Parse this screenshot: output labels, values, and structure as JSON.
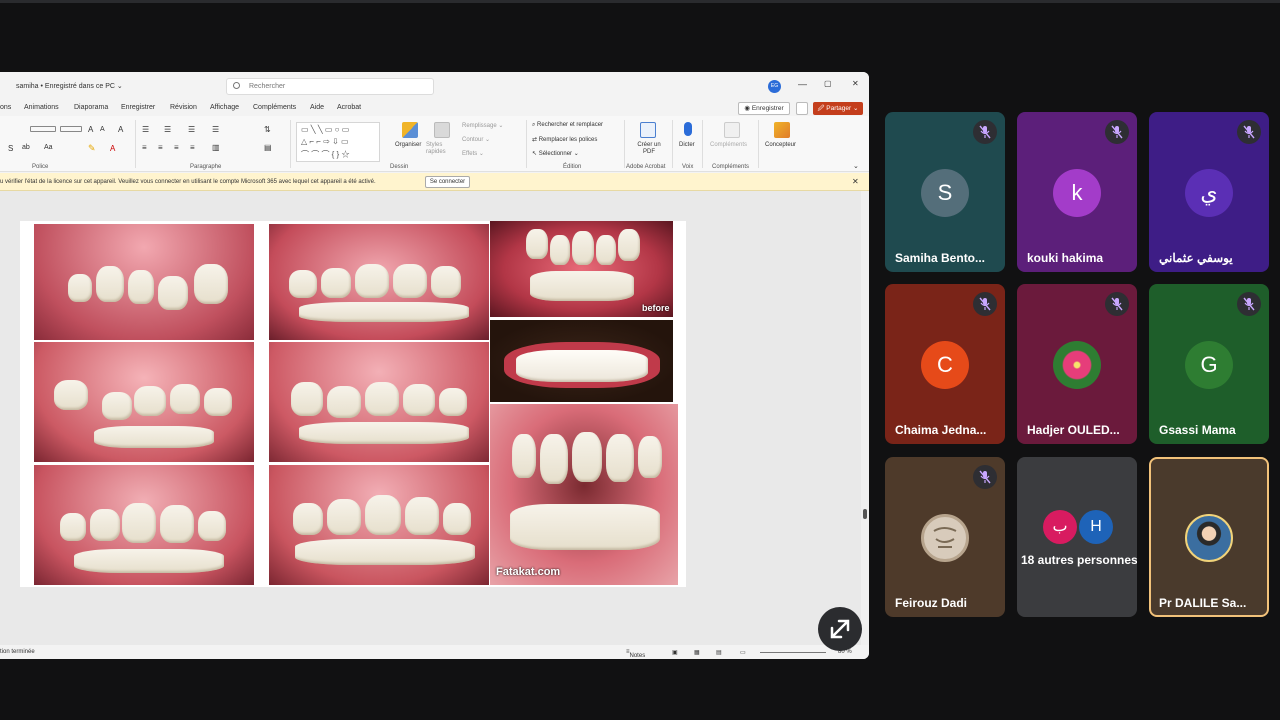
{
  "window": {
    "doc_title": "samiha • Enregistré dans ce PC ⌄",
    "search_placeholder": "Rechercher",
    "user_initials": "EG",
    "minimize": "—",
    "maximize": "▢",
    "close": "✕"
  },
  "menu": [
    "ons",
    "Animations",
    "Diaporama",
    "Enregistrer",
    "Révision",
    "Affichage",
    "Compléments",
    "Aide",
    "Acrobat"
  ],
  "actions": {
    "record": "◉ Enregistrer",
    "share": "🖉 Partager ⌄"
  },
  "ribbon": {
    "groups": [
      "Police",
      "Paragraphe",
      "Dessin",
      "Édition",
      "Adobe Acrobat",
      "Voix",
      "Compléments"
    ],
    "find_replace": "Rechercher et remplacer",
    "replace_fonts": "Remplacer les polices",
    "select": "Sélectionner ⌄",
    "organize": "Organiser",
    "quick_styles": "Styles rapides",
    "fill": "Remplissage ⌄",
    "outline": "Contour ⌄",
    "effects": "Effets ⌄",
    "create_pdf": "Créer un PDF",
    "dictate": "Dicter",
    "addins": "Compléments",
    "designer": "Concepteur"
  },
  "infobar": {
    "message": "u vérifier l'état de la licence sur cet appareil. Veuillez vous connecter en utilisant le compte Microsoft 365 avec lequel cet appareil a été activé.",
    "signin": "Se connecter",
    "dismiss": "✕"
  },
  "slide": {
    "caption_before": "before",
    "caption_watermark": "Fatakat.com"
  },
  "status": {
    "left": "tion terminée",
    "notes": "Notes",
    "zoom": "80 %"
  },
  "participants": [
    {
      "name": "Samiha Bento...",
      "initial": "S",
      "avatar_color": "#546e7a",
      "bg": "#1f4a4f",
      "muted": true
    },
    {
      "name": "kouki hakima",
      "initial": "k",
      "avatar_color": "#a33cc9",
      "bg": "#5c1f7a",
      "muted": true
    },
    {
      "name": "يوسفي عثماني",
      "initial": "ي",
      "avatar_color": "#5b2fb5",
      "bg": "#3e1d86",
      "muted": true
    },
    {
      "name": "Chaima Jedna...",
      "initial": "C",
      "avatar_color": "#e64a19",
      "bg": "#7a2418",
      "muted": true
    },
    {
      "name": "Hadjer OULED...",
      "initial": "",
      "avatar_color": "#2e7d32",
      "bg": "#6b1a3c",
      "muted": true
    },
    {
      "name": "Gsassi Mama",
      "initial": "G",
      "avatar_color": "#2e7d32",
      "bg": "#1e5e2a",
      "muted": true
    },
    {
      "name": "Feirouz Dadi",
      "initial": "",
      "avatar_color": "#c9b9a4",
      "bg": "#4e3a2a",
      "muted": true
    },
    {
      "name": "18 autres personnes",
      "initial": "",
      "avatar_color": "",
      "bg": "#3b3c3f",
      "muted": false
    },
    {
      "name": "Pr DALILE Sa...",
      "initial": "",
      "avatar_color": "#3b6ea0",
      "bg": "#4a3a2c",
      "muted": false
    }
  ],
  "others": {
    "initial_a": "ب",
    "initial_b": "H"
  },
  "colors": {
    "accent_share": "#c43e1c",
    "active_speaker_border": "#f2c27a",
    "mute_icon_bg": "#2e2e33"
  }
}
